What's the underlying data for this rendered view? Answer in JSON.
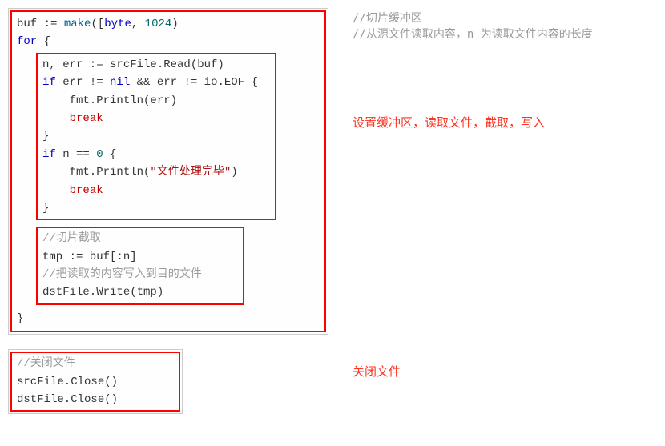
{
  "code": {
    "l1_buf": "buf ",
    "l1_assign": ":=",
    "l1_make": " make",
    "l1_paren_open": "([",
    "l1_paren_close": "]",
    "l1_byte": "byte",
    "l1_comma": ", ",
    "l1_num": "1024",
    "l1_close": ")",
    "l2_for": "for",
    "l2_brace": " {",
    "l3_read": "n, err := srcFile.Read(buf)",
    "l4_if": "if",
    "l4_rest1": " err != ",
    "l4_nil": "nil",
    "l4_rest2": " && err != io.EOF {",
    "l5_fmt": "    fmt.Println(err)",
    "l6_break": "break",
    "l7_close": "}",
    "l8_if": "if",
    "l8_rest": " n == ",
    "l8_zero": "0",
    "l8_brace": " {",
    "l9_fmt_open": "    fmt.Println(",
    "l9_str": "\"文件处理完毕\"",
    "l9_close": ")",
    "l10_break": "break",
    "l11_close": "}",
    "slice_cmt": "//切片截取",
    "slice_line": "tmp := buf[:n]",
    "write_cmt": "//把读取的内容写入到目的文件",
    "write_line": "dstFile.Write(tmp)",
    "outer_close": "}",
    "close_cmt": "//关闭文件",
    "close_l1": "srcFile.Close()",
    "close_l2": "dstFile.Close()"
  },
  "anno": {
    "cmt1": "//切片缓冲区",
    "cmt2": "//从源文件读取内容，n 为读取文件内容的长度",
    "red1": "设置缓冲区，读取文件，截取，写入",
    "red2": "关闭文件"
  }
}
